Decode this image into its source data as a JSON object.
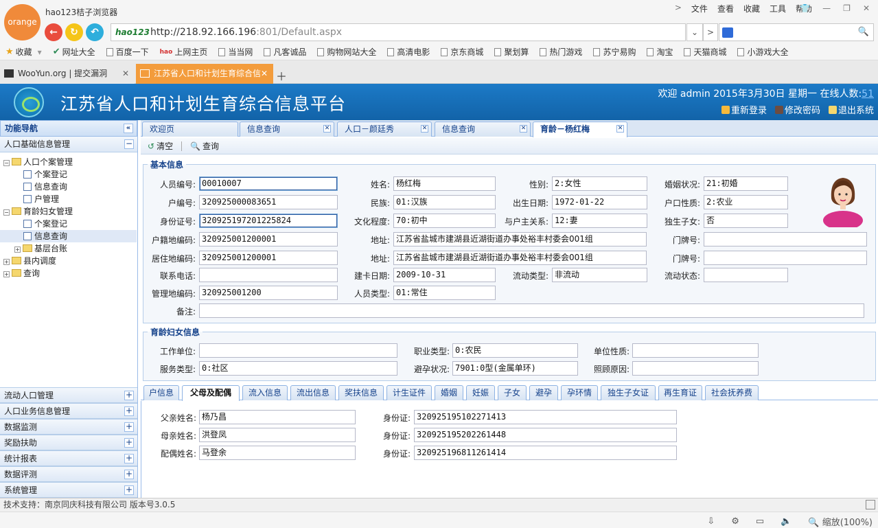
{
  "browser": {
    "logo_text": "orange",
    "name": "hao123桔子浏览器",
    "menu": [
      "文件",
      "查看",
      "收藏",
      "工具",
      "帮助"
    ],
    "address_logo": "hao123",
    "url_host": "http://218.92.166.196",
    "url_rest": ":801/Default.aspx",
    "bookmarks": [
      "收藏",
      "网址大全",
      "百度一下",
      "上网主页",
      "当当网",
      "凡客诚品",
      "购物网站大全",
      "高清电影",
      "京东商城",
      "聚划算",
      "热门游戏",
      "苏宁易购",
      "淘宝",
      "天猫商城",
      "小游戏大全"
    ],
    "tabs": [
      {
        "label": "WooYun.org | 提交漏洞"
      },
      {
        "label": "江苏省人口和计划生育综合信"
      }
    ],
    "zoom": "缩放(100%)"
  },
  "header": {
    "title": "江苏省人口和计划生育综合信息平台",
    "welcome": "欢迎 admin 2015年3月30日 星期一 在线人数:",
    "online_count": "51",
    "relogin": "重新登录",
    "change_password": "修改密码",
    "logout": "退出系统"
  },
  "sidebar": {
    "title": "功能导航",
    "top_panel": "人口基础信息管理",
    "tree": [
      {
        "label": "人口个案管理",
        "level": 0,
        "type": "folder",
        "expanded": true
      },
      {
        "label": "个案登记",
        "level": 1,
        "type": "doc"
      },
      {
        "label": "信息查询",
        "level": 1,
        "type": "doc"
      },
      {
        "label": "户管理",
        "level": 1,
        "type": "doc"
      },
      {
        "label": "育龄妇女管理",
        "level": 0,
        "type": "folder",
        "expanded": true
      },
      {
        "label": "个案登记",
        "level": 1,
        "type": "doc"
      },
      {
        "label": "信息查询",
        "level": 1,
        "type": "doc",
        "selected": true
      },
      {
        "label": "基层台账",
        "level": 1,
        "type": "folder",
        "expanded": false
      },
      {
        "label": "县内调度",
        "level": 0,
        "type": "folder",
        "expanded": false
      },
      {
        "label": "查询",
        "level": 0,
        "type": "folder",
        "expanded": false
      }
    ],
    "panels": [
      "流动人口管理",
      "人口业务信息管理",
      "数据监测",
      "奖励扶助",
      "统计报表",
      "数据评测",
      "系统管理"
    ]
  },
  "main": {
    "tabs": [
      {
        "label": "欢迎页",
        "closable": false
      },
      {
        "label": "信息查询",
        "closable": true
      },
      {
        "label": "人口－颜廷秀",
        "closable": true
      },
      {
        "label": "信息查询",
        "closable": true
      },
      {
        "label": "育龄－杨红梅",
        "closable": true,
        "active": true
      }
    ],
    "toolbar": {
      "clear": "清空",
      "query": "查询"
    },
    "basic": {
      "legend": "基本信息",
      "labels": {
        "person_id": "人员编号:",
        "name": "姓名:",
        "gender": "性别:",
        "marital": "婚姻状况:",
        "household_id": "户编号:",
        "ethnicity": "民族:",
        "birth_date": "出生日期:",
        "hukou_type": "户口性质:",
        "id_card": "身份证号:",
        "education": "文化程度:",
        "relation": "与户主关系:",
        "only_child": "独生子女:",
        "reg_code": "户籍地编码:",
        "address1": "地址:",
        "door1": "门牌号:",
        "res_code": "居住地编码:",
        "address2": "地址:",
        "door2": "门牌号:",
        "phone": "联系电话:",
        "card_date": "建卡日期:",
        "flow_type": "流动类型:",
        "flow_status": "流动状态:",
        "mgmt_code": "管理地编码:",
        "person_type": "人员类型:",
        "remark": "备注:"
      },
      "values": {
        "person_id": "00010007",
        "name": "杨红梅",
        "gender": "2:女性",
        "marital": "21:初婚",
        "household_id": "320925000083651",
        "ethnicity": "01:汉族",
        "birth_date": "1972-01-22",
        "hukou_type": "2:农业",
        "id_card": "320925197201225824",
        "education": "70:初中",
        "relation": "12:妻",
        "only_child": "否",
        "reg_code": "320925001200001",
        "address1": "江苏省盐城市建湖县近湖街道办事处裕丰村委会001组",
        "door1": "",
        "res_code": "320925001200001",
        "address2": "江苏省盐城市建湖县近湖街道办事处裕丰村委会001组",
        "door2": "",
        "phone": "",
        "card_date": "2009-10-31",
        "flow_type": "非流动",
        "flow_status": "",
        "mgmt_code": "320925001200",
        "person_type": "01:常住",
        "remark": ""
      }
    },
    "women": {
      "legend": "育龄妇女信息",
      "labels": {
        "work_unit": "工作单位:",
        "job_type": "职业类型:",
        "unit_nature": "单位性质:",
        "service_type": "服务类型:",
        "contraception": "避孕状况:",
        "care_reason": "照顾原因:"
      },
      "values": {
        "work_unit": "",
        "job_type": "0:农民",
        "unit_nature": "",
        "service_type": "0:社区",
        "contraception": "7901:0型(金属单环)",
        "care_reason": ""
      }
    },
    "subtabs": [
      "户信息",
      "父母及配偶",
      "流入信息",
      "流出信息",
      "奖扶信息",
      "计生证件",
      "婚姻",
      "妊娠",
      "子女",
      "避孕",
      "孕环情",
      "独生子女证",
      "再生育证",
      "社会抚养费"
    ],
    "active_subtab": "父母及配偶",
    "family": {
      "labels": {
        "father": "父亲姓名:",
        "mother": "母亲姓名:",
        "spouse": "配偶姓名:",
        "id": "身份证:"
      },
      "father_name": "杨乃昌",
      "father_id": "320925195102271413",
      "mother_name": "洪登凤",
      "mother_id": "320925195202261448",
      "spouse_name": "马登余",
      "spouse_id": "320925196811261414"
    }
  },
  "status": {
    "text": "技术支持：南京同庆科技有限公司 版本号3.0.5"
  }
}
